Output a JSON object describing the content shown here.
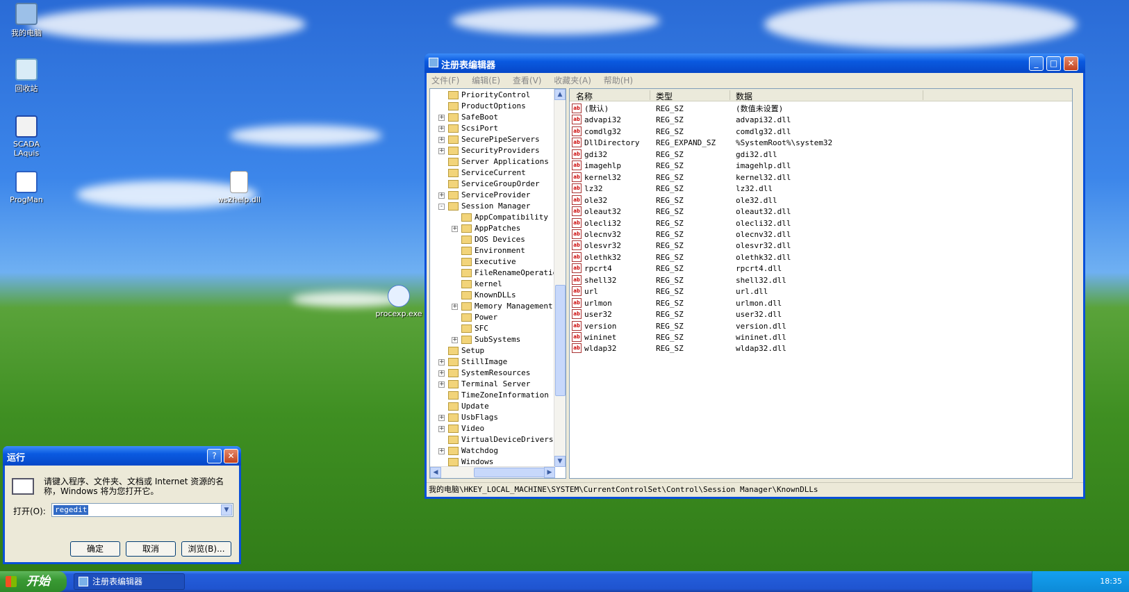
{
  "desktop": {
    "icons": [
      {
        "label": "我的电脑"
      },
      {
        "label": "回收站"
      },
      {
        "label": "SCADA LAquis"
      },
      {
        "label": "ProgMan"
      },
      {
        "label": "ws2help.dll"
      },
      {
        "label": "procexp.exe"
      }
    ]
  },
  "regedit": {
    "title": "注册表编辑器",
    "buttons": {
      "minimize": "_",
      "maximize": "□",
      "close": "✕"
    },
    "menu": [
      "文件(F)",
      "编辑(E)",
      "查看(V)",
      "收藏夹(A)",
      "帮助(H)"
    ],
    "tree": [
      {
        "label": "PriorityControl",
        "level": 0,
        "expander": ""
      },
      {
        "label": "ProductOptions",
        "level": 0,
        "expander": ""
      },
      {
        "label": "SafeBoot",
        "level": 0,
        "expander": "+"
      },
      {
        "label": "ScsiPort",
        "level": 0,
        "expander": "+"
      },
      {
        "label": "SecurePipeServers",
        "level": 0,
        "expander": "+"
      },
      {
        "label": "SecurityProviders",
        "level": 0,
        "expander": "+"
      },
      {
        "label": "Server Applications",
        "level": 0,
        "expander": ""
      },
      {
        "label": "ServiceCurrent",
        "level": 0,
        "expander": ""
      },
      {
        "label": "ServiceGroupOrder",
        "level": 0,
        "expander": ""
      },
      {
        "label": "ServiceProvider",
        "level": 0,
        "expander": "+"
      },
      {
        "label": "Session Manager",
        "level": 0,
        "expander": "-"
      },
      {
        "label": "AppCompatibility",
        "level": 1,
        "expander": ""
      },
      {
        "label": "AppPatches",
        "level": 1,
        "expander": "+"
      },
      {
        "label": "DOS Devices",
        "level": 1,
        "expander": ""
      },
      {
        "label": "Environment",
        "level": 1,
        "expander": ""
      },
      {
        "label": "Executive",
        "level": 1,
        "expander": ""
      },
      {
        "label": "FileRenameOperations",
        "level": 1,
        "expander": ""
      },
      {
        "label": "kernel",
        "level": 1,
        "expander": ""
      },
      {
        "label": "KnownDLLs",
        "level": 1,
        "expander": ""
      },
      {
        "label": "Memory Management",
        "level": 1,
        "expander": "+"
      },
      {
        "label": "Power",
        "level": 1,
        "expander": ""
      },
      {
        "label": "SFC",
        "level": 1,
        "expander": ""
      },
      {
        "label": "SubSystems",
        "level": 1,
        "expander": "+"
      },
      {
        "label": "Setup",
        "level": 0,
        "expander": ""
      },
      {
        "label": "StillImage",
        "level": 0,
        "expander": "+"
      },
      {
        "label": "SystemResources",
        "level": 0,
        "expander": "+"
      },
      {
        "label": "Terminal Server",
        "level": 0,
        "expander": "+"
      },
      {
        "label": "TimeZoneInformation",
        "level": 0,
        "expander": ""
      },
      {
        "label": "Update",
        "level": 0,
        "expander": ""
      },
      {
        "label": "UsbFlags",
        "level": 0,
        "expander": "+"
      },
      {
        "label": "Video",
        "level": 0,
        "expander": "+"
      },
      {
        "label": "VirtualDeviceDrivers",
        "level": 0,
        "expander": ""
      },
      {
        "label": "Watchdog",
        "level": 0,
        "expander": "+"
      },
      {
        "label": "Windows",
        "level": 0,
        "expander": ""
      }
    ],
    "columns": [
      "名称",
      "类型",
      "数据"
    ],
    "values": [
      {
        "name": "(默认)",
        "type": "REG_SZ",
        "data": "(数值未设置)"
      },
      {
        "name": "advapi32",
        "type": "REG_SZ",
        "data": "advapi32.dll"
      },
      {
        "name": "comdlg32",
        "type": "REG_SZ",
        "data": "comdlg32.dll"
      },
      {
        "name": "DllDirectory",
        "type": "REG_EXPAND_SZ",
        "data": "%SystemRoot%\\system32"
      },
      {
        "name": "gdi32",
        "type": "REG_SZ",
        "data": "gdi32.dll"
      },
      {
        "name": "imagehlp",
        "type": "REG_SZ",
        "data": "imagehlp.dll"
      },
      {
        "name": "kernel32",
        "type": "REG_SZ",
        "data": "kernel32.dll"
      },
      {
        "name": "lz32",
        "type": "REG_SZ",
        "data": "lz32.dll"
      },
      {
        "name": "ole32",
        "type": "REG_SZ",
        "data": "ole32.dll"
      },
      {
        "name": "oleaut32",
        "type": "REG_SZ",
        "data": "oleaut32.dll"
      },
      {
        "name": "olecli32",
        "type": "REG_SZ",
        "data": "olecli32.dll"
      },
      {
        "name": "olecnv32",
        "type": "REG_SZ",
        "data": "olecnv32.dll"
      },
      {
        "name": "olesvr32",
        "type": "REG_SZ",
        "data": "olesvr32.dll"
      },
      {
        "name": "olethk32",
        "type": "REG_SZ",
        "data": "olethk32.dll"
      },
      {
        "name": "rpcrt4",
        "type": "REG_SZ",
        "data": "rpcrt4.dll"
      },
      {
        "name": "shell32",
        "type": "REG_SZ",
        "data": "shell32.dll"
      },
      {
        "name": "url",
        "type": "REG_SZ",
        "data": "url.dll"
      },
      {
        "name": "urlmon",
        "type": "REG_SZ",
        "data": "urlmon.dll"
      },
      {
        "name": "user32",
        "type": "REG_SZ",
        "data": "user32.dll"
      },
      {
        "name": "version",
        "type": "REG_SZ",
        "data": "version.dll"
      },
      {
        "name": "wininet",
        "type": "REG_SZ",
        "data": "wininet.dll"
      },
      {
        "name": "wldap32",
        "type": "REG_SZ",
        "data": "wldap32.dll"
      }
    ],
    "status_path": "我的电脑\\HKEY_LOCAL_MACHINE\\SYSTEM\\CurrentControlSet\\Control\\Session Manager\\KnownDLLs"
  },
  "run_dialog": {
    "title": "运行",
    "help": "?",
    "close": "✕",
    "description": "请键入程序、文件夹、文档或 Internet 资源的名称，Windows 将为您打开它。",
    "open_label": "打开(O):",
    "input_value": "regedit",
    "ok": "确定",
    "cancel": "取消",
    "browse": "浏览(B)..."
  },
  "taskbar": {
    "start_label": "开始",
    "task_label": "注册表编辑器",
    "clock": "18:35"
  }
}
